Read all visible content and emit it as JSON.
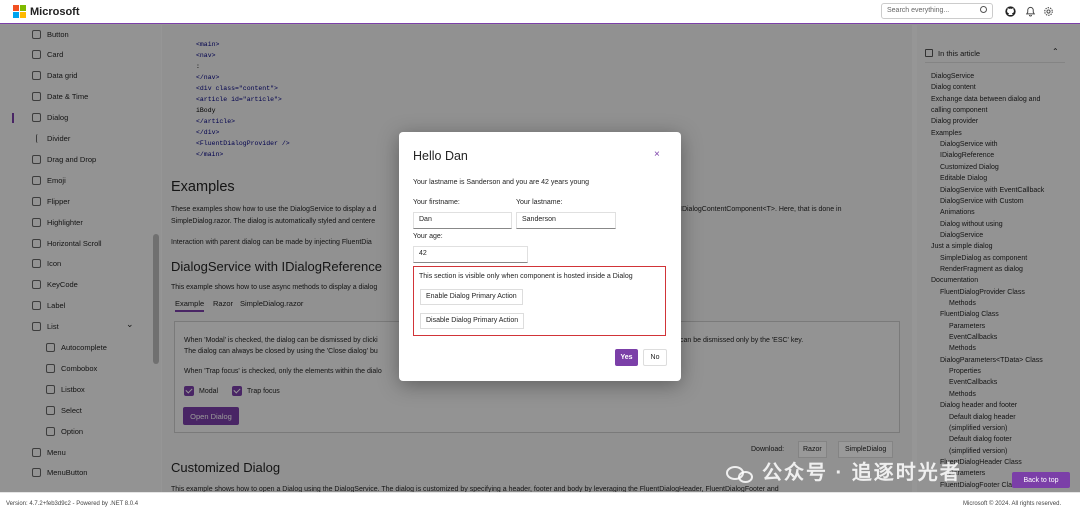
{
  "header": {
    "brand": "Microsoft",
    "logo_colors": [
      "#f25022",
      "#7fba00",
      "#00a4ef",
      "#ffb900"
    ],
    "search_placeholder": "Search everything...",
    "icons": [
      "search-icon",
      "github-icon",
      "bell-icon",
      "gear-icon"
    ]
  },
  "sidebar": {
    "items": [
      {
        "label": "Button",
        "sub": false,
        "icon": "button-icon"
      },
      {
        "label": "Card",
        "sub": false,
        "icon": "card-icon"
      },
      {
        "label": "Data grid",
        "sub": false,
        "icon": "grid-icon"
      },
      {
        "label": "Date & Time",
        "sub": false,
        "icon": "calendar-icon"
      },
      {
        "label": "Dialog",
        "sub": false,
        "icon": "dialog-icon",
        "active": true
      },
      {
        "label": "Divider",
        "sub": false,
        "icon": "divider-icon"
      },
      {
        "label": "Drag and Drop",
        "sub": false,
        "icon": "drag-icon"
      },
      {
        "label": "Emoji",
        "sub": false,
        "icon": "emoji-icon"
      },
      {
        "label": "Flipper",
        "sub": false,
        "icon": "flipper-icon"
      },
      {
        "label": "Highlighter",
        "sub": false,
        "icon": "highlighter-icon"
      },
      {
        "label": "Horizontal Scroll",
        "sub": false,
        "icon": "scroll-icon"
      },
      {
        "label": "Icon",
        "sub": false,
        "icon": "icon-icon"
      },
      {
        "label": "KeyCode",
        "sub": false,
        "icon": "keyboard-icon"
      },
      {
        "label": "Label",
        "sub": false,
        "icon": "label-icon"
      },
      {
        "label": "List",
        "sub": false,
        "icon": "list-icon",
        "expanded": true
      },
      {
        "label": "Autocomplete",
        "sub": true,
        "icon": "autocomplete-icon"
      },
      {
        "label": "Combobox",
        "sub": true,
        "icon": "combobox-icon"
      },
      {
        "label": "Listbox",
        "sub": true,
        "icon": "listbox-icon"
      },
      {
        "label": "Select",
        "sub": true,
        "icon": "select-icon"
      },
      {
        "label": "Option",
        "sub": true,
        "icon": "option-icon"
      },
      {
        "label": "Menu",
        "sub": false,
        "icon": "menu-icon"
      },
      {
        "label": "MenuButton",
        "sub": false,
        "icon": "menubutton-icon"
      }
    ]
  },
  "main": {
    "code_lines": [
      "<main>",
      "<nav>",
      ":",
      "</nav>",
      "<div class=\"content\">",
      "<article id=\"article\">",
      "iBody",
      "</article>",
      "</div>",
      "<FluentDialogProvider />",
      "</main>"
    ],
    "examples_heading": "Examples",
    "examples_text_1": "These examples show how to use the DialogService to display a d",
    "examples_text_1b": "IDialogContentComponent<T>. Here, that is done in",
    "examples_text_2": "SimpleDialog.razor. The dialog is automatically styled and centere",
    "examples_text_3": "Interaction with parent dialog can be made by injecting FluentDia",
    "section_heading": "DialogService with IDialogReference",
    "section_text": "This example shows how to use async methods to display a dialog",
    "tabs": [
      "Example",
      "Razor",
      "SimpleDialog.razor"
    ],
    "demo_text_1": "When 'Modal' is checked, the dialog can be dismissed by clicki",
    "demo_text_1b": "can be dismissed only by the 'ESC' key.",
    "demo_text_2": "The dialog can always be closed by using the 'Close dialog' bu",
    "demo_text_3": "When 'Trap focus' is checked, only the elements within the dialo",
    "checkbox_modal": "Modal",
    "checkbox_trap": "Trap focus",
    "open_dialog": "Open Dialog",
    "download_label": "Download:",
    "download_razor": "Razor",
    "download_simple": "SimpleDialog",
    "customized_heading": "Customized Dialog",
    "customized_text": "This example shows how to open a Dialog using the DialogService. The dialog is customized by specifying a header, footer and body by leveraging the FluentDialogHeader, FluentDialogFooter and"
  },
  "toc": {
    "title": "In this article",
    "items": [
      {
        "label": "DialogService",
        "level": 0
      },
      {
        "label": "Dialog content",
        "level": 0
      },
      {
        "label": "Exchange data between dialog and",
        "level": 0
      },
      {
        "label": "calling component",
        "level": 0
      },
      {
        "label": "Dialog provider",
        "level": 0
      },
      {
        "label": "Examples",
        "level": 0
      },
      {
        "label": "DialogService with",
        "level": 1
      },
      {
        "label": "IDialogReference",
        "level": 1
      },
      {
        "label": "Customized Dialog",
        "level": 1
      },
      {
        "label": "Editable Dialog",
        "level": 1
      },
      {
        "label": "DialogService with EventCallback",
        "level": 1
      },
      {
        "label": "DialogService with Custom",
        "level": 1
      },
      {
        "label": "Animations",
        "level": 1
      },
      {
        "label": "Dialog without using",
        "level": 1
      },
      {
        "label": "DialogService",
        "level": 1
      },
      {
        "label": "Just a simple dialog",
        "level": 0
      },
      {
        "label": "SimpleDialog as component",
        "level": 1
      },
      {
        "label": "RenderFragment as dialog",
        "level": 1
      },
      {
        "label": "Documentation",
        "level": 0
      },
      {
        "label": "FluentDialogProvider Class",
        "level": 1
      },
      {
        "label": "Methods",
        "level": 2
      },
      {
        "label": "FluentDialog Class",
        "level": 1
      },
      {
        "label": "Parameters",
        "level": 2
      },
      {
        "label": "EventCallbacks",
        "level": 2
      },
      {
        "label": "Methods",
        "level": 2
      },
      {
        "label": "DialogParameters<TData> Class",
        "level": 1
      },
      {
        "label": "Properties",
        "level": 2
      },
      {
        "label": "EventCallbacks",
        "level": 2
      },
      {
        "label": "Methods",
        "level": 2
      },
      {
        "label": "Dialog header and footer",
        "level": 1
      },
      {
        "label": "Default dialog header",
        "level": 2
      },
      {
        "label": "(simplified version)",
        "level": 2
      },
      {
        "label": "Default dialog footer",
        "level": 2
      },
      {
        "label": "(simplified version)",
        "level": 2
      },
      {
        "label": "FluentDialogHeader Class",
        "level": 1
      },
      {
        "label": "Parameters",
        "level": 2
      },
      {
        "label": "FluentDialogFooter Class",
        "level": 1
      }
    ],
    "back_to_top": "Back to top"
  },
  "dialog": {
    "title": "Hello Dan",
    "close": "×",
    "message": "Your lastname is Sanderson and you are 42 years young",
    "firstname_label": "Your firstname:",
    "firstname_value": "Dan",
    "lastname_label": "Your lastname:",
    "lastname_value": "Sanderson",
    "age_label": "Your age:",
    "age_value": "42",
    "section_text": "This section is visible only when component is hosted inside a Dialog",
    "enable_btn": "Enable Dialog Primary Action",
    "disable_btn": "Disable Dialog Primary Action",
    "yes": "Yes",
    "no": "No"
  },
  "footer": {
    "version": "Version: 4.7.2+feb3d9c2  -  Powered by .NET 8.0.4",
    "copyright": "Microsoft © 2024. All rights reserved."
  },
  "watermark": "公众号 · 追逐时光者",
  "colors": {
    "accent": "#7b3fa8",
    "section_border": "#d13438"
  }
}
